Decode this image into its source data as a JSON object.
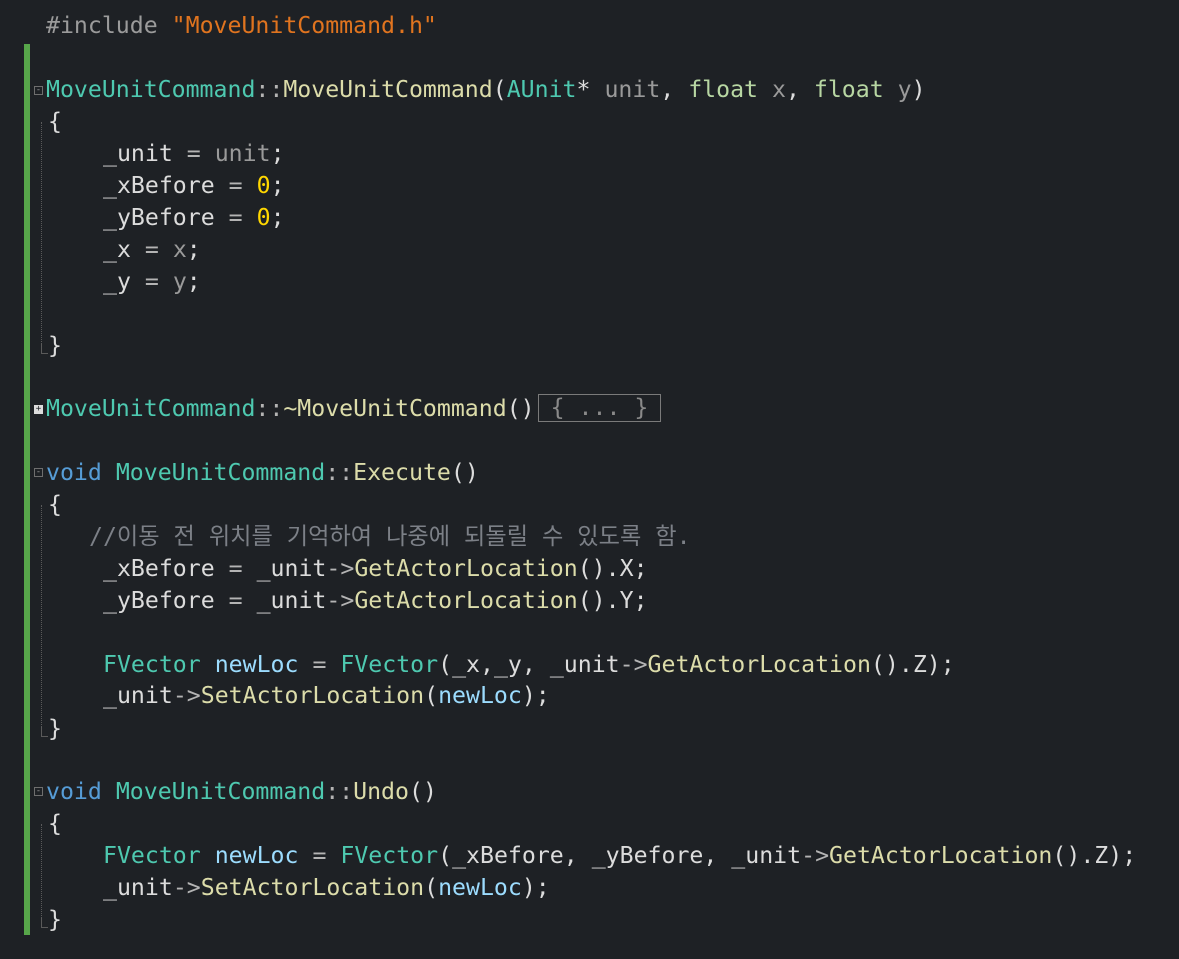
{
  "editor": {
    "include_directive": "#include",
    "include_file": "\"MoveUnitCommand.h\"",
    "class_name": "MoveUnitCommand",
    "scope": "::",
    "ctor_name": "MoveUnitCommand",
    "ctor_params": {
      "type1": "AUnit",
      "ptr": "*",
      "name1": "unit",
      "type2": "float",
      "name2": "x",
      "type3": "float",
      "name3": "y"
    },
    "ctor_body": [
      {
        "lhs": "_unit",
        "rhs": "unit"
      },
      {
        "lhs": "_xBefore",
        "rhs": "0"
      },
      {
        "lhs": "_yBefore",
        "rhs": "0"
      },
      {
        "lhs": "_x",
        "rhs": "x"
      },
      {
        "lhs": "_y",
        "rhs": "y"
      }
    ],
    "dtor_name": "~MoveUnitCommand",
    "collapsed_text": "{ ... }",
    "void_kw": "void",
    "execute_name": "Execute",
    "execute_comment": "//이동 전 위치를 기억하여 나중에 되돌릴 수 있도록 함.",
    "member_unit": "_unit",
    "x_before": "_xBefore",
    "y_before": "_yBefore",
    "get_loc": "GetActorLocation",
    "set_loc": "SetActorLocation",
    "fvector": "FVector",
    "new_loc": "newLoc",
    "x_field": "_x",
    "y_field": "_y",
    "undo_name": "Undo",
    "axis_x": "X",
    "axis_y": "Y",
    "axis_z": "Z"
  }
}
